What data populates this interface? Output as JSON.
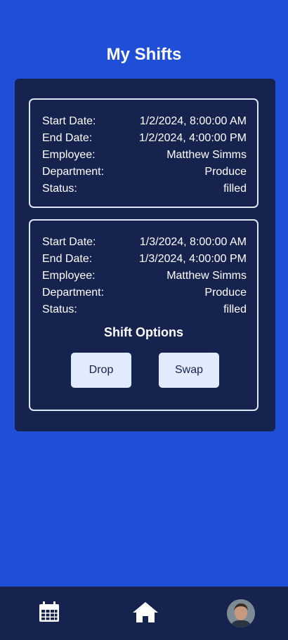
{
  "header": {
    "title": "My Shifts"
  },
  "labels": {
    "start_date": "Start Date:",
    "end_date": "End Date:",
    "employee": "Employee:",
    "department": "Department:",
    "status": "Status:"
  },
  "shifts": [
    {
      "start_date": "1/2/2024, 8:00:00 AM",
      "end_date": "1/2/2024, 4:00:00 PM",
      "employee": "Matthew Simms",
      "department": "Produce",
      "status": "filled"
    },
    {
      "start_date": "1/3/2024, 8:00:00 AM",
      "end_date": "1/3/2024, 4:00:00 PM",
      "employee": "Matthew Simms",
      "department": "Produce",
      "status": "filled"
    }
  ],
  "shift_options": {
    "title": "Shift Options",
    "drop_label": "Drop",
    "swap_label": "Swap"
  },
  "nav": {
    "items": [
      {
        "icon": "calendar-icon"
      },
      {
        "icon": "home-icon"
      },
      {
        "icon": "avatar"
      }
    ]
  },
  "colors": {
    "background": "#1e4fd6",
    "panel": "#16234f",
    "button": "#e1ebfd",
    "card_border": "#dfe6f3"
  }
}
